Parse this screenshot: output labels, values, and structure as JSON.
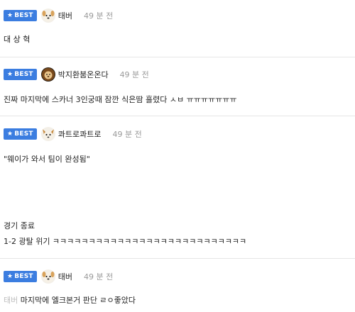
{
  "best_label": "BEST",
  "comments": [
    {
      "nickname": "태버",
      "time": "49 분 전",
      "avatar_icon": "dog-face-icon",
      "lines": [
        "대 상 혁"
      ]
    },
    {
      "nickname": "박지환붐온온다",
      "time": "49 분 전",
      "avatar_icon": "lion-face-icon",
      "lines": [
        "진짜 마지막에 스카너 3인궁때 잠깐 식은땀 흘렸다 ㅅㅂ ㅠㅠㅠㅠㅠㅠㅠ"
      ]
    },
    {
      "nickname": "콰트로콰트로",
      "time": "49 분 전",
      "avatar_icon": "dog-face-icon",
      "lines": [
        "\"웨이가 와서 팀이 완성됨\"",
        "경기 종료",
        "1-2 광탈 위기 ㅋㅋㅋㅋㅋㅋㅋㅋㅋㅋㅋㅋㅋㅋㅋㅋㅋㅋㅋㅋㅋㅋㅋㅋㅋㅋㅋ"
      ]
    },
    {
      "nickname": "태버",
      "time": "49 분 전",
      "avatar_icon": "dog-face-icon",
      "reply_to": "태버",
      "lines": [
        " 마지막에 엘크본거 판단 ㄹㅇ좋았다"
      ]
    }
  ]
}
